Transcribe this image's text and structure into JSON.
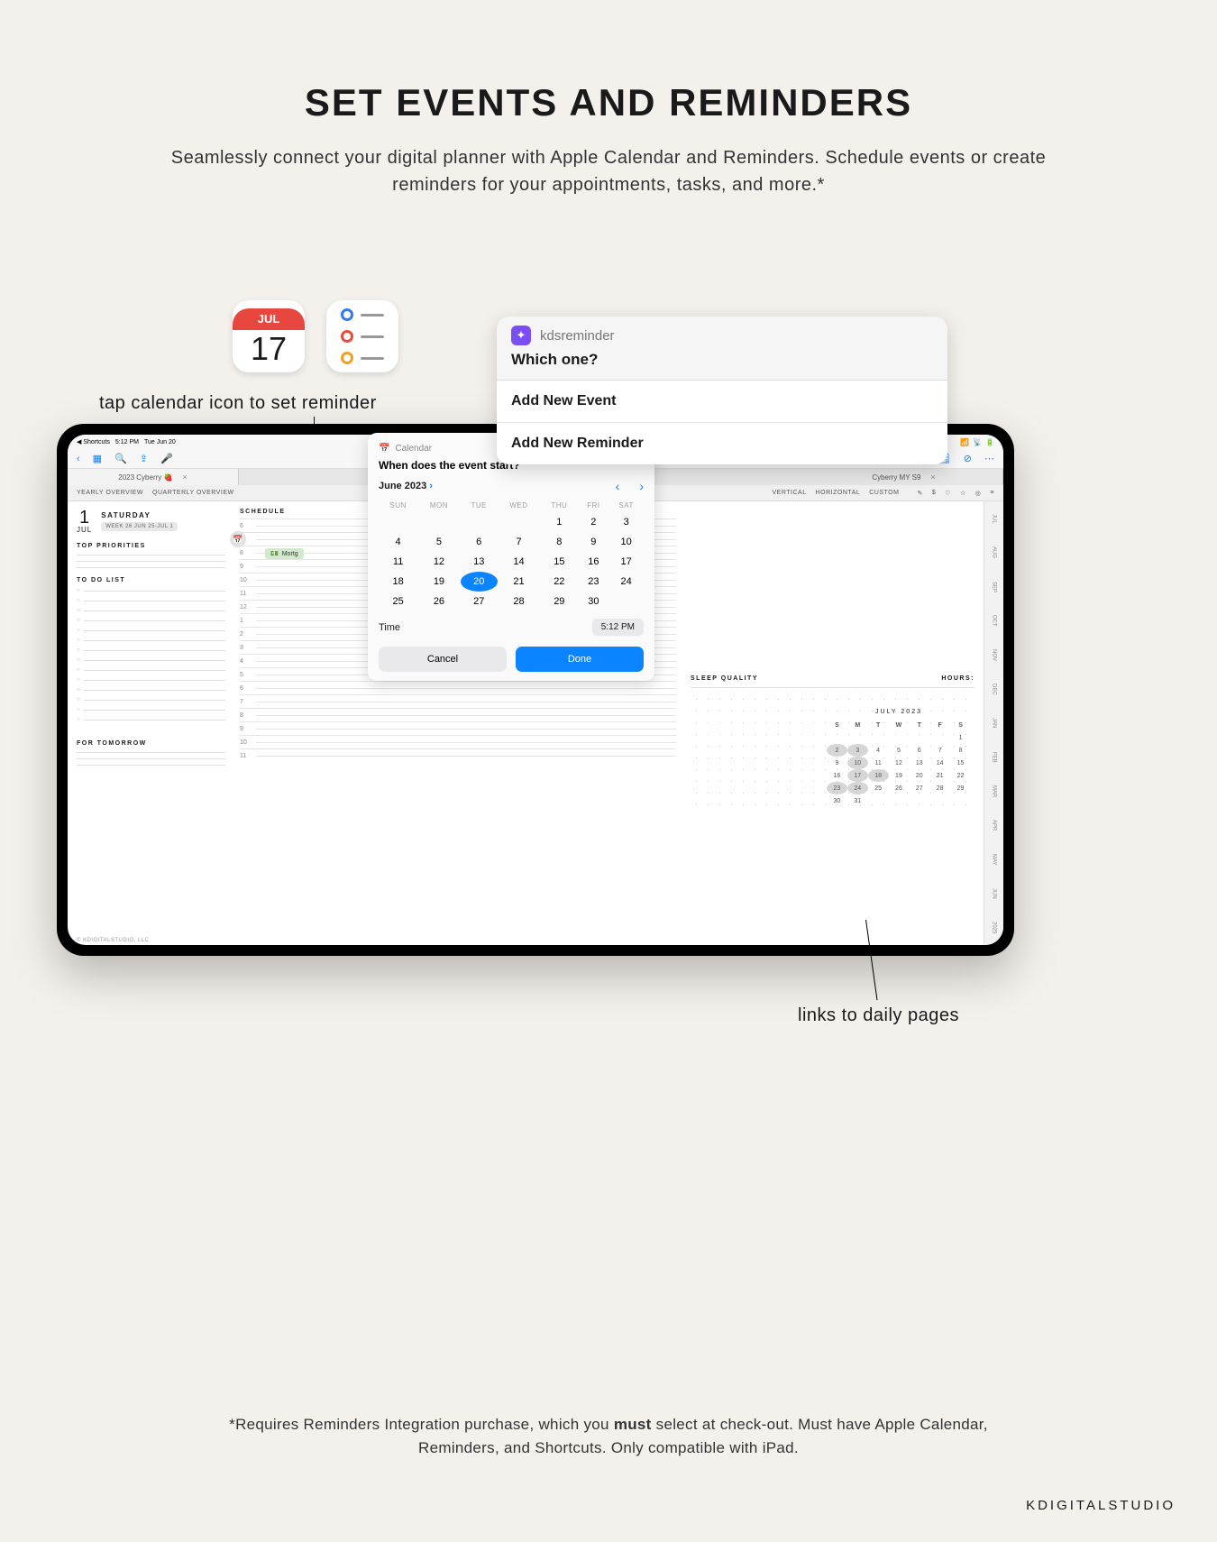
{
  "title": "SET EVENTS AND REMINDERS",
  "subtitle": "Seamlessly connect your digital planner with Apple Calendar and Reminders. Schedule events or create reminders for your appointments, tasks, and more.*",
  "annotations": {
    "tap": "tap calendar icon to set reminder",
    "links": "links to daily pages"
  },
  "apps": {
    "calendar": {
      "month": "JUL",
      "day": "17"
    }
  },
  "statusbar": {
    "shortcuts": "Shortcuts",
    "time": "5:12 PM",
    "date": "Tue Jun 20"
  },
  "tabs": {
    "left": "2023 Cyberry 🍓",
    "right": "Cyberry MY S9"
  },
  "toolbar_segments": {
    "left": [
      "YEARLY OVERVIEW",
      "QUARTERLY OVERVIEW"
    ],
    "right": [
      "VERTICAL",
      "HORIZONTAL",
      "CUSTOM"
    ]
  },
  "planner": {
    "day_num": "1",
    "day_month": "JUL",
    "day_name": "SATURDAY",
    "week": "WEEK 26  JUN 25-JUL 1",
    "top_priorities": "TOP PRIORITIES",
    "todo": "TO DO LIST",
    "tomorrow": "FOR TOMORROW",
    "schedule": "SCHEDULE",
    "event": "Mortg",
    "hours": [
      "6",
      "7",
      "8",
      "9",
      "10",
      "11",
      "12",
      "1",
      "2",
      "3",
      "4",
      "5",
      "6",
      "7",
      "8",
      "9",
      "10",
      "11"
    ],
    "sleep": "SLEEP QUALITY",
    "hours_label": "HOURS:",
    "footer": "© KDIGITALSTUDIO, LLC"
  },
  "sidetabs": [
    "JUL",
    "AUG",
    "SEP",
    "OCT",
    "NOV",
    "DEC",
    "JAN",
    "FEB",
    "MAR",
    "APR",
    "MAY",
    "JUN",
    "2025"
  ],
  "minicalendar": {
    "title": "JULY 2023",
    "dow": [
      "S",
      "M",
      "T",
      "W",
      "T",
      "F",
      "S"
    ],
    "rows": [
      [
        "",
        "",
        "",
        "",
        "",
        "",
        "1"
      ],
      [
        "2",
        "3",
        "4",
        "5",
        "6",
        "7",
        "8"
      ],
      [
        "9",
        "10",
        "11",
        "12",
        "13",
        "14",
        "15"
      ],
      [
        "16",
        "17",
        "18",
        "19",
        "20",
        "21",
        "22"
      ],
      [
        "23",
        "24",
        "25",
        "26",
        "27",
        "28",
        "29"
      ],
      [
        "30",
        "31",
        "",
        "",
        "",
        "",
        ""
      ]
    ],
    "highlighted": [
      "2",
      "3",
      "10",
      "17",
      "18",
      "23",
      "24"
    ]
  },
  "datepicker": {
    "app": "Calendar",
    "question": "When does the event start?",
    "month": "June 2023",
    "dow": [
      "SUN",
      "MON",
      "TUE",
      "WED",
      "THU",
      "FRI",
      "SAT"
    ],
    "rows": [
      [
        "",
        "",
        "",
        "",
        "1",
        "2",
        "3"
      ],
      [
        "4",
        "5",
        "6",
        "7",
        "8",
        "9",
        "10"
      ],
      [
        "11",
        "12",
        "13",
        "14",
        "15",
        "16",
        "17"
      ],
      [
        "18",
        "19",
        "20",
        "21",
        "22",
        "23",
        "24"
      ],
      [
        "25",
        "26",
        "27",
        "28",
        "29",
        "30",
        ""
      ]
    ],
    "selected": "20",
    "time_label": "Time",
    "time_value": "5:12 PM",
    "cancel": "Cancel",
    "done": "Done"
  },
  "reminder": {
    "app": "kdsreminder",
    "question": "Which one?",
    "options": [
      "Add New Event",
      "Add  New Reminder"
    ]
  },
  "disclaimer_a": "*Requires Reminders Integration purchase, which you ",
  "disclaimer_b": "must",
  "disclaimer_c": " select at check-out. Must have Apple Calendar, Reminders, and Shortcuts. Only compatible with iPad.",
  "brand": "KDIGITALSTUDIO"
}
